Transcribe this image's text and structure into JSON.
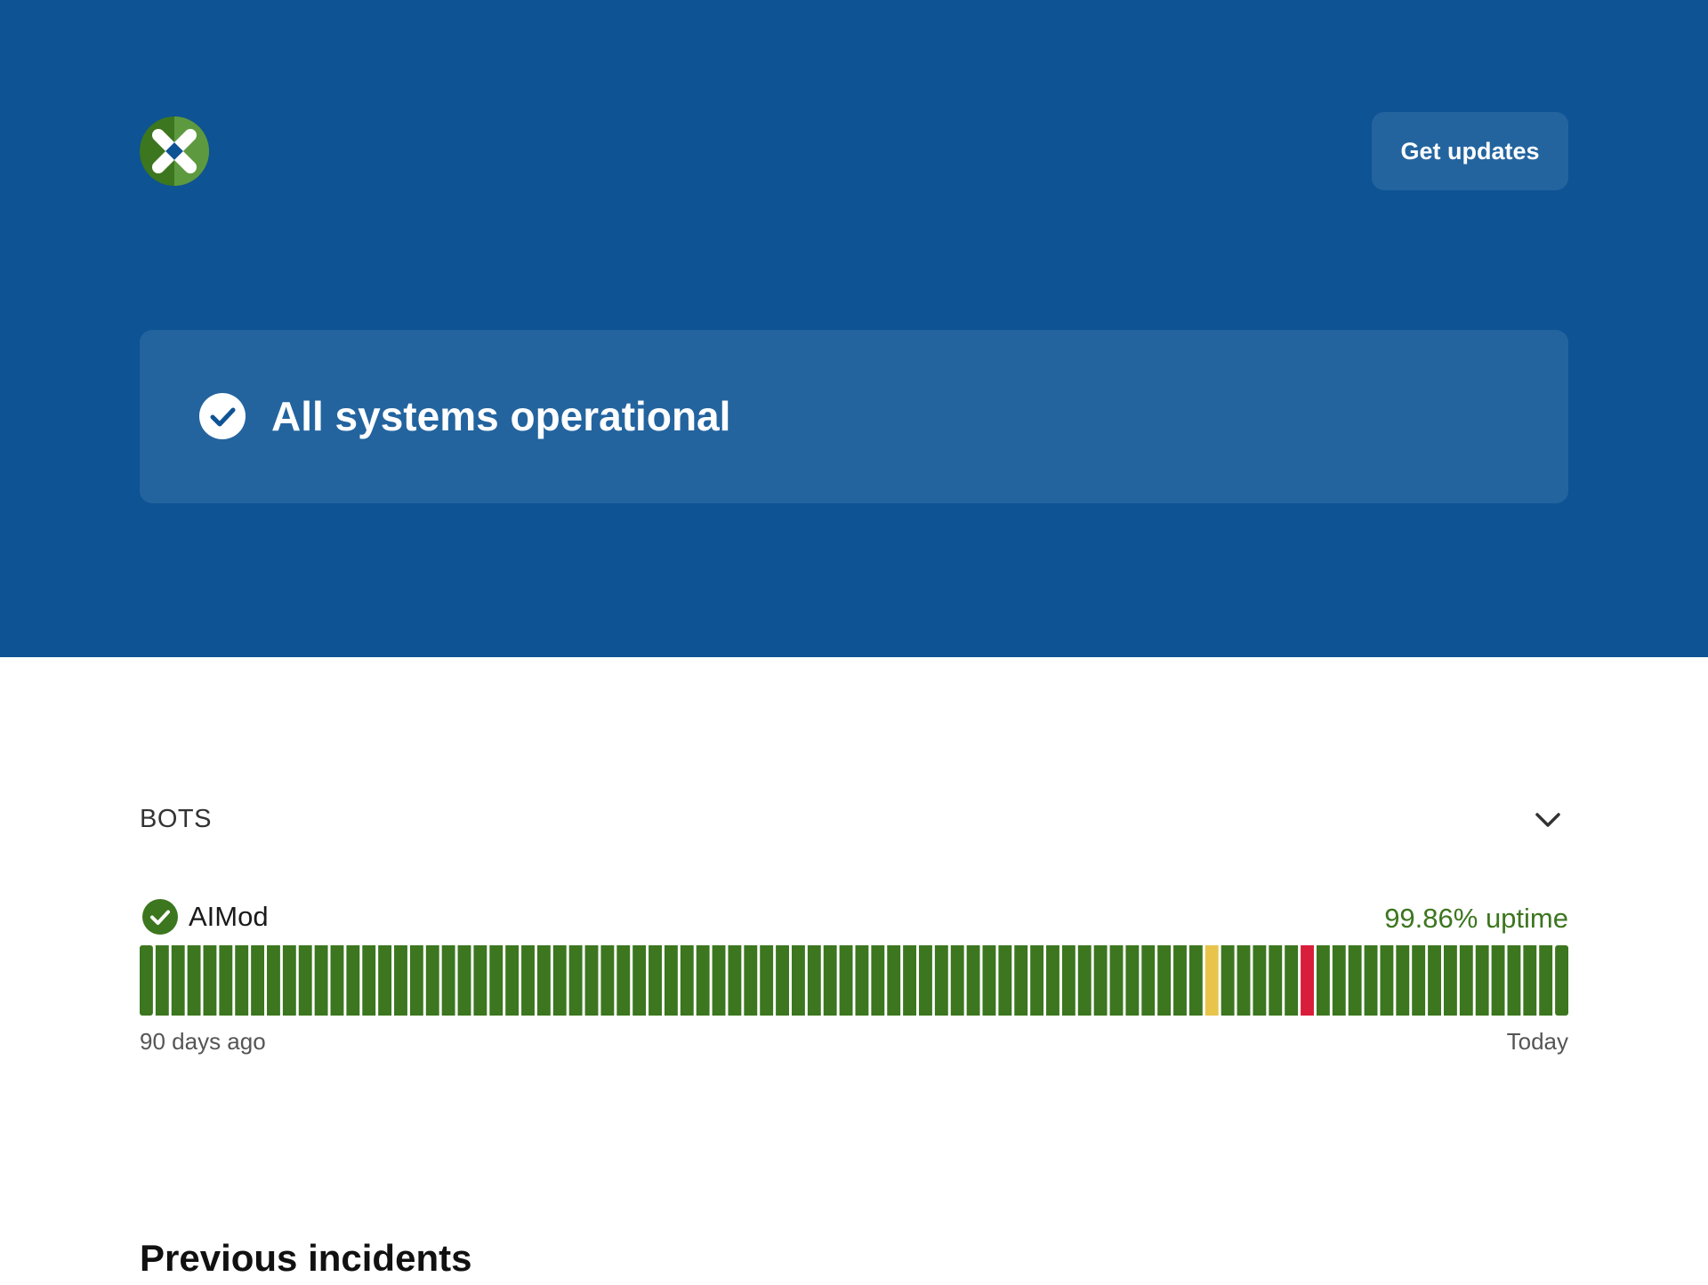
{
  "header": {
    "logo_icon": "x-cross-logo-icon",
    "get_updates_label": "Get updates",
    "brand_color": "#0e5394"
  },
  "status": {
    "icon": "check-circle-icon",
    "text": "All systems operational"
  },
  "group": {
    "title": "BOTS",
    "toggle_icon": "chevron-down-icon"
  },
  "component": {
    "icon": "check-circle-icon",
    "name": "AIMod",
    "uptime": "99.86% uptime",
    "uptime_color": "#3c761f",
    "days_total": 90,
    "day_status_colors": {
      "operational": "#3c761f",
      "degraded": "#e8c44a",
      "outage": "#d81e3a"
    },
    "degraded_days": [
      67
    ],
    "outage_days": [
      73
    ],
    "label_start": "90 days ago",
    "label_end": "Today"
  },
  "incidents": {
    "title": "Previous incidents"
  }
}
